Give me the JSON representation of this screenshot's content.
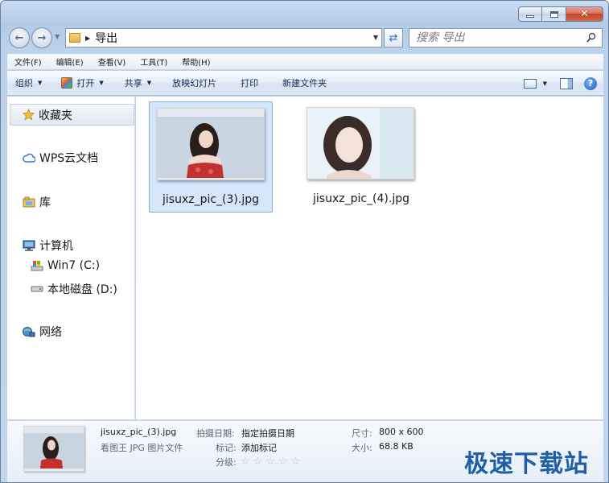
{
  "window": {
    "caption_buttons": {
      "minimize": "minimize",
      "maximize": "maximize",
      "close": "✕"
    }
  },
  "address_bar": {
    "path": "导出",
    "search_placeholder": "搜索 导出"
  },
  "menubar": {
    "items": [
      "文件(F)",
      "编辑(E)",
      "查看(V)",
      "工具(T)",
      "帮助(H)"
    ]
  },
  "commandbar": {
    "organize": "组织",
    "open": "打开",
    "share": "共享",
    "slideshow": "放映幻灯片",
    "print": "打印",
    "new_folder": "新建文件夹"
  },
  "nav_pane": {
    "favorites": "收藏夹",
    "wps_cloud": "WPS云文档",
    "libraries": "库",
    "computer": "计算机",
    "drive_c": "Win7 (C:)",
    "drive_d": "本地磁盘 (D:)",
    "network": "网络"
  },
  "files": [
    {
      "name": "jisuxz_pic_(3).jpg",
      "selected": true
    },
    {
      "name": "jisuxz_pic_(4).jpg",
      "selected": false
    }
  ],
  "details": {
    "file_name": "jisuxz_pic_(3).jpg",
    "file_type": "看图王 JPG 图片文件",
    "date_taken_label": "拍摄日期:",
    "date_taken_value": "指定拍摄日期",
    "tags_label": "标记:",
    "tags_value": "添加标记",
    "rating_label": "分级:",
    "rating_value": 0,
    "rating_max": 5,
    "dimensions_label": "尺寸:",
    "dimensions_value": "800 x 600",
    "size_label": "大小:",
    "size_value": "68.8 KB"
  },
  "watermark": "极速下载站",
  "colors": {
    "selection": "#d6e7fb",
    "selection_border": "#84acdd",
    "watermark": "#1f5fa8"
  }
}
